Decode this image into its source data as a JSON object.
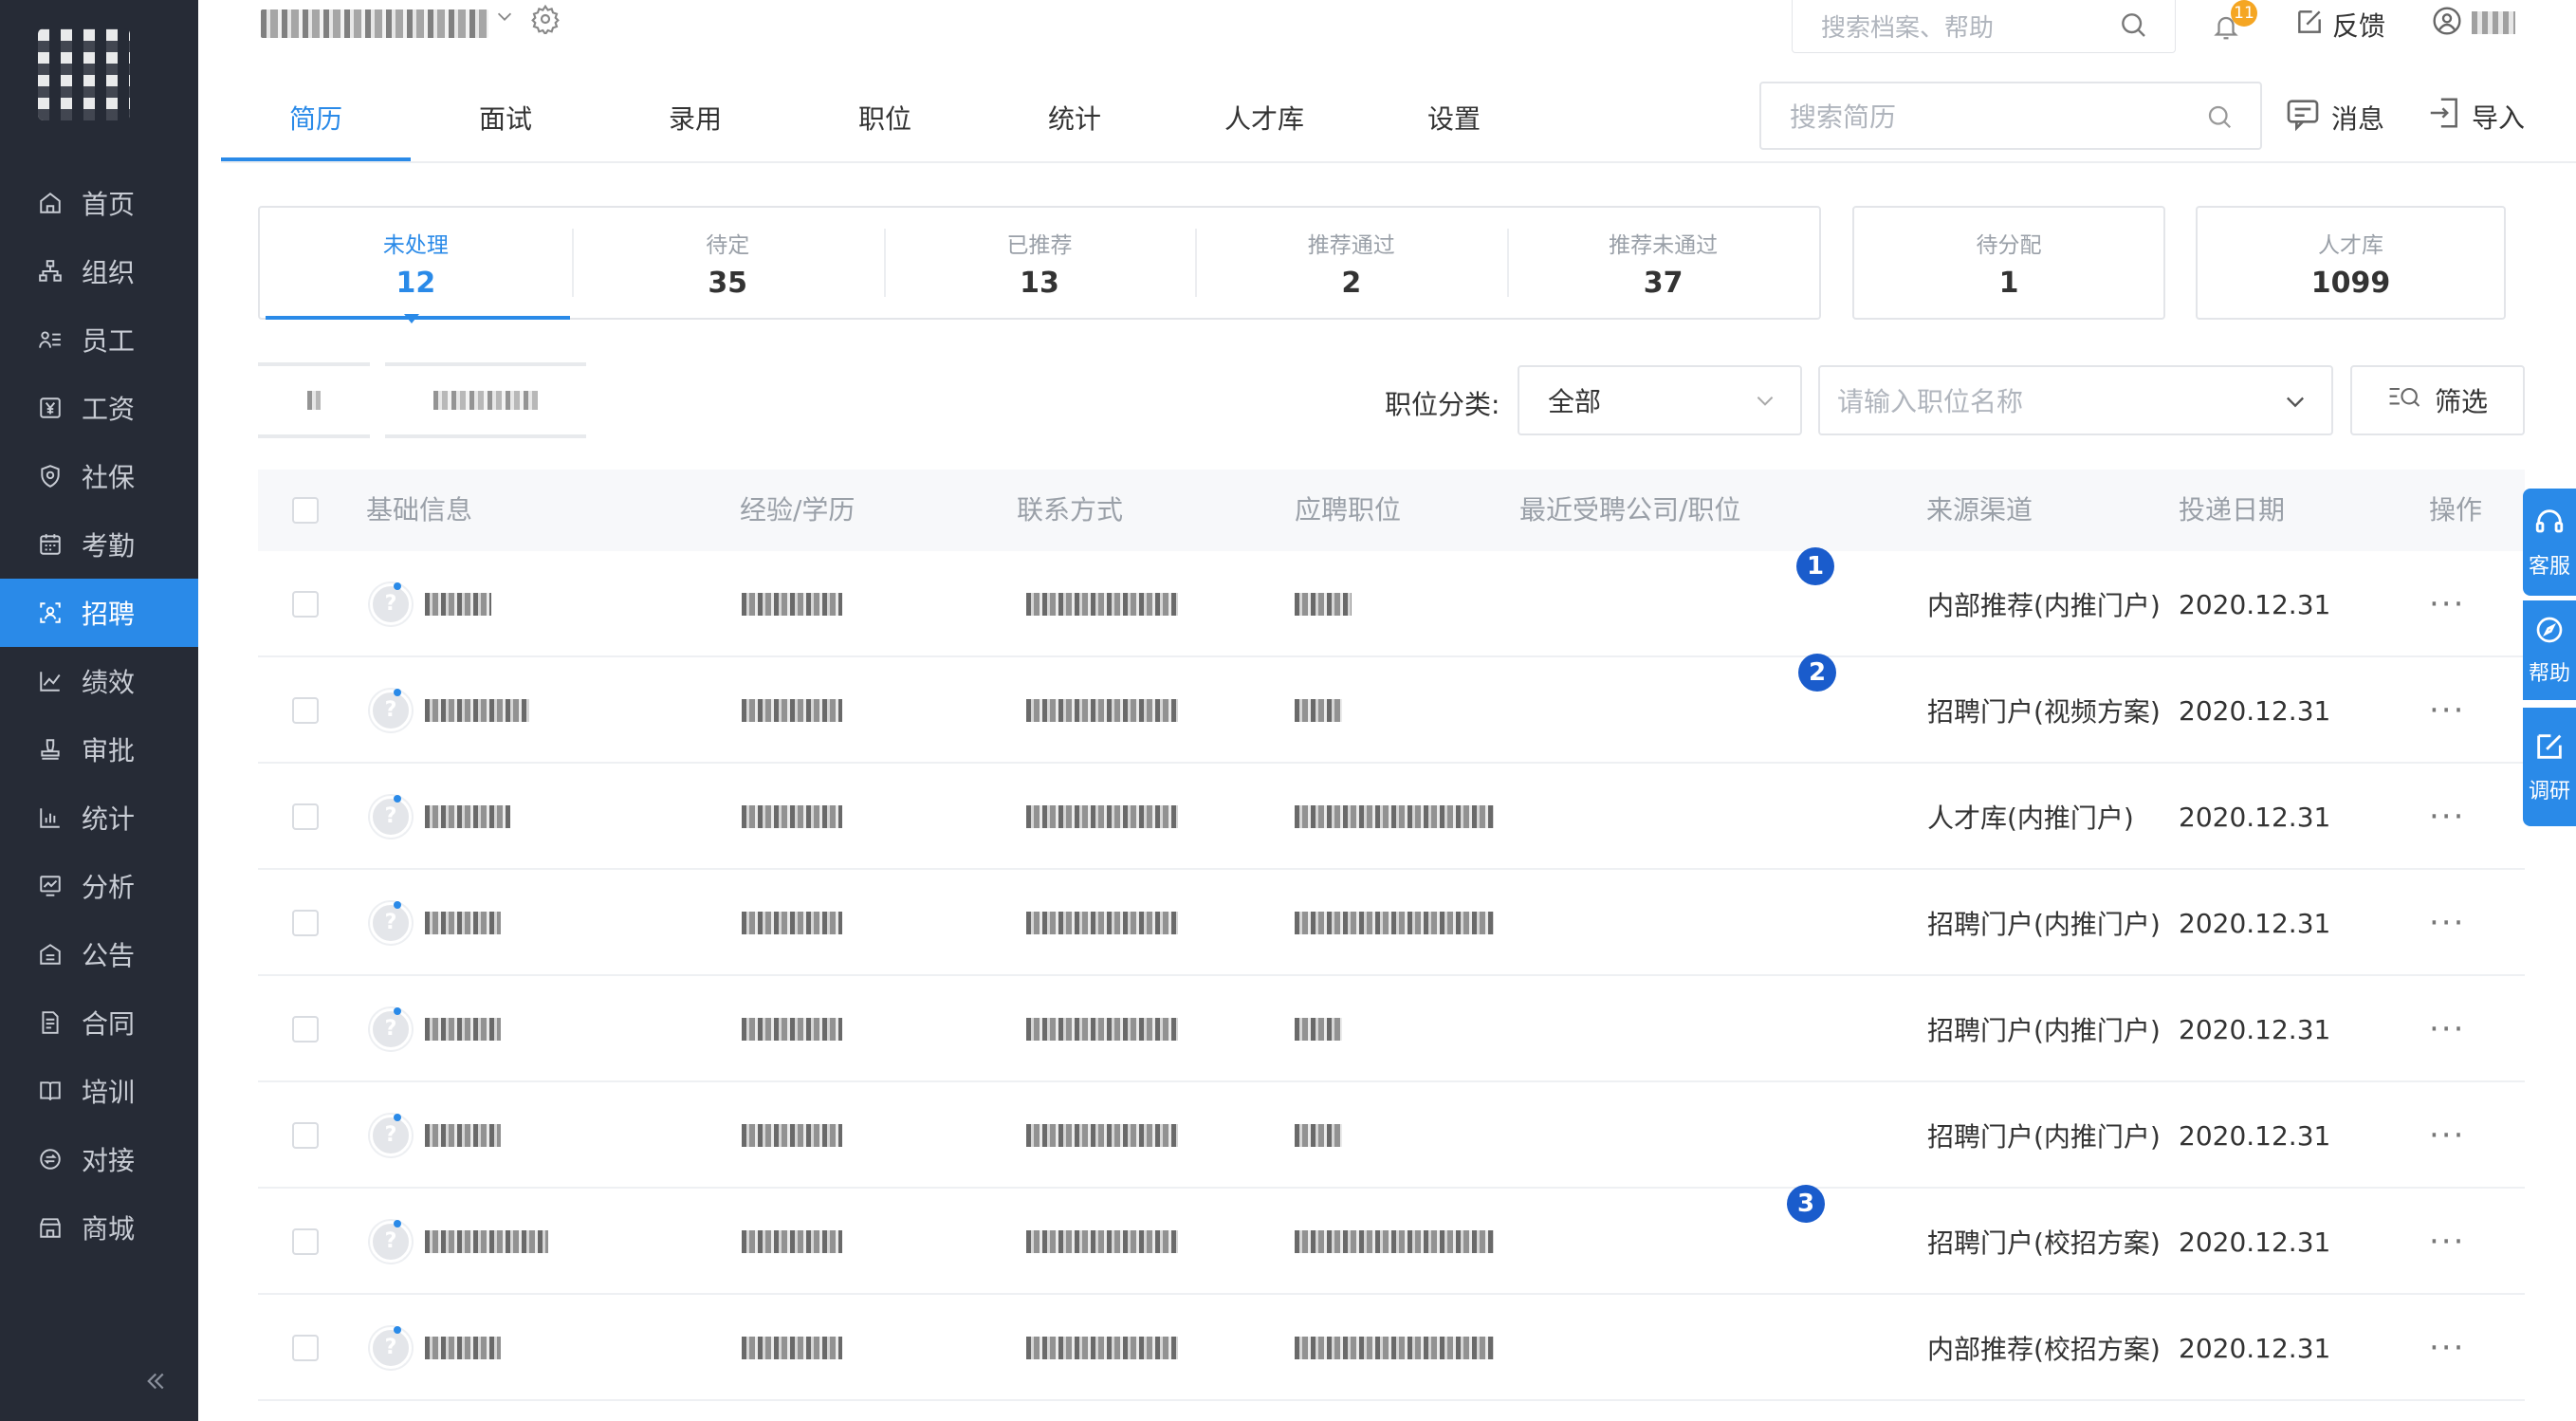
{
  "sidebar": {
    "items": [
      {
        "label": "首页",
        "icon": "home-icon"
      },
      {
        "label": "组织",
        "icon": "org-icon"
      },
      {
        "label": "员工",
        "icon": "staff-icon"
      },
      {
        "label": "工资",
        "icon": "salary-icon"
      },
      {
        "label": "社保",
        "icon": "shield-icon"
      },
      {
        "label": "考勤",
        "icon": "calendar-icon"
      },
      {
        "label": "招聘",
        "icon": "recruit-icon",
        "active": true
      },
      {
        "label": "绩效",
        "icon": "chart-line-icon"
      },
      {
        "label": "审批",
        "icon": "stamp-icon"
      },
      {
        "label": "统计",
        "icon": "bar-chart-icon"
      },
      {
        "label": "分析",
        "icon": "analysis-icon"
      },
      {
        "label": "公告",
        "icon": "notice-icon"
      },
      {
        "label": "合同",
        "icon": "contract-icon"
      },
      {
        "label": "培训",
        "icon": "book-icon"
      },
      {
        "label": "对接",
        "icon": "link-icon"
      },
      {
        "label": "商城",
        "icon": "shop-icon"
      }
    ]
  },
  "topbar": {
    "search_placeholder": "搜索档案、帮助",
    "bell_badge": "11",
    "feedback_label": "反馈"
  },
  "tabs": [
    {
      "label": "简历",
      "active": true
    },
    {
      "label": "面试"
    },
    {
      "label": "录用"
    },
    {
      "label": "职位"
    },
    {
      "label": "统计"
    },
    {
      "label": "人才库"
    },
    {
      "label": "设置"
    }
  ],
  "resume_search_placeholder": "搜索简历",
  "messages_label": "消息",
  "import_label": "导入",
  "stats": [
    {
      "label": "未处理",
      "value": "12",
      "active": true
    },
    {
      "label": "待定",
      "value": "35"
    },
    {
      "label": "已推荐",
      "value": "13"
    },
    {
      "label": "推荐通过",
      "value": "2"
    },
    {
      "label": "推荐未通过",
      "value": "37"
    }
  ],
  "stat_cards": [
    {
      "label": "待分配",
      "value": "1"
    },
    {
      "label": "人才库",
      "value": "1099"
    }
  ],
  "filter": {
    "category_label": "职位分类:",
    "category_value": "全部",
    "position_placeholder": "请输入职位名称",
    "filter_button": "筛选"
  },
  "table": {
    "headers": [
      "基础信息",
      "经验/学历",
      "联系方式",
      "应聘职位",
      "最近受聘公司/职位",
      "来源渠道",
      "投递日期",
      "操作"
    ],
    "rows": [
      {
        "source": "内部推荐(内推门户)",
        "date": "2020.12.31",
        "marker": "1"
      },
      {
        "source": "招聘门户(视频方案)",
        "date": "2020.12.31",
        "marker": "2"
      },
      {
        "source": "人才库(内推门户)",
        "date": "2020.12.31"
      },
      {
        "source": "招聘门户(内推门户)",
        "date": "2020.12.31"
      },
      {
        "source": "招聘门户(内推门户)",
        "date": "2020.12.31"
      },
      {
        "source": "招聘门户(内推门户)",
        "date": "2020.12.31"
      },
      {
        "source": "招聘门户(校招方案)",
        "date": "2020.12.31",
        "marker": "3"
      },
      {
        "source": "内部推荐(校招方案)",
        "date": "2020.12.31"
      }
    ],
    "more_label": "···"
  },
  "float_panel": [
    {
      "label": "客服",
      "icon": "headset-icon"
    },
    {
      "label": "帮助",
      "icon": "compass-icon"
    },
    {
      "label": "调研",
      "icon": "edit-icon"
    }
  ],
  "colors": {
    "accent": "#2a8ae8",
    "sidebar_bg": "#262b36",
    "marker": "#1a5ccc",
    "badge": "#f5a623"
  }
}
